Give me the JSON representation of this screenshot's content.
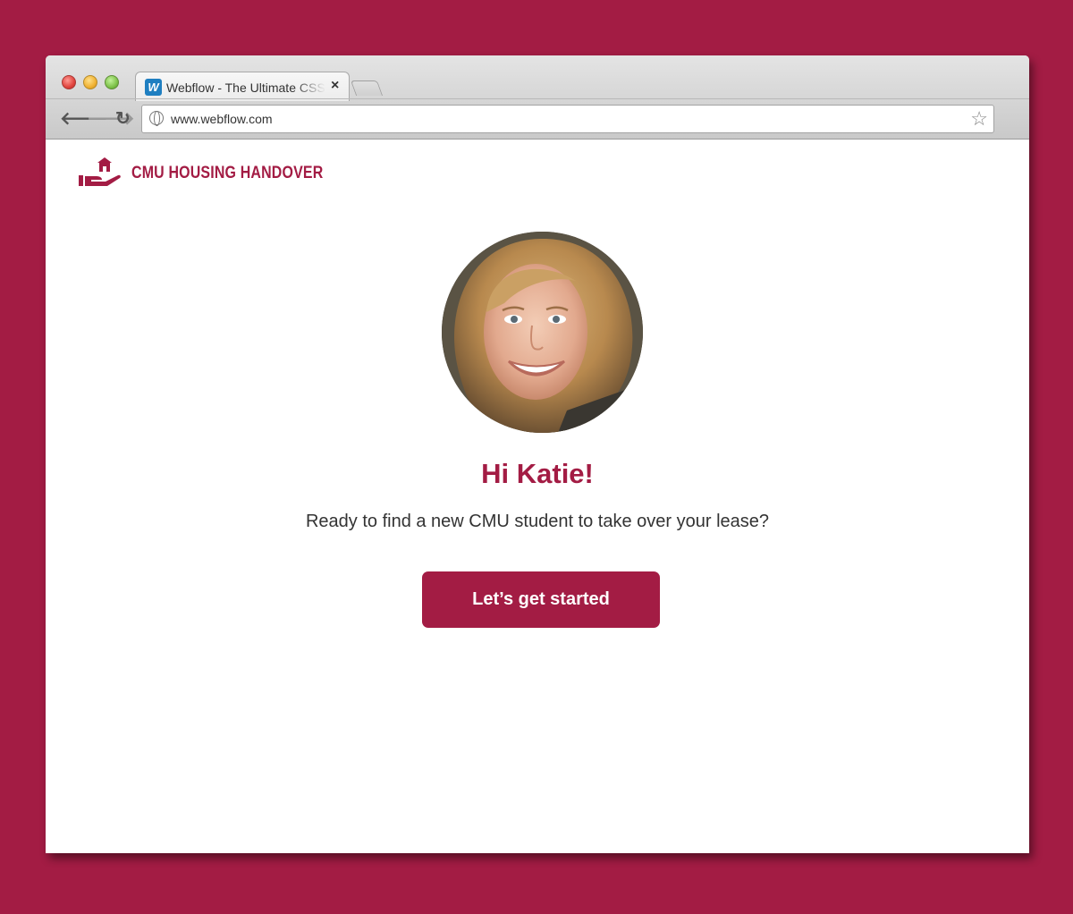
{
  "browser": {
    "tab_title": "Webflow - The Ultimate CSS",
    "tab_favicon_letter": "W",
    "url": "www.webflow.com"
  },
  "site": {
    "brand": "CMU HOUSING HANDOVER"
  },
  "main": {
    "greeting": "Hi Katie!",
    "tagline": "Ready to find a new CMU student to take over your lease?",
    "cta_label": "Let’s get started"
  },
  "colors": {
    "brand": "#a31c44",
    "background": "#a31c44"
  }
}
